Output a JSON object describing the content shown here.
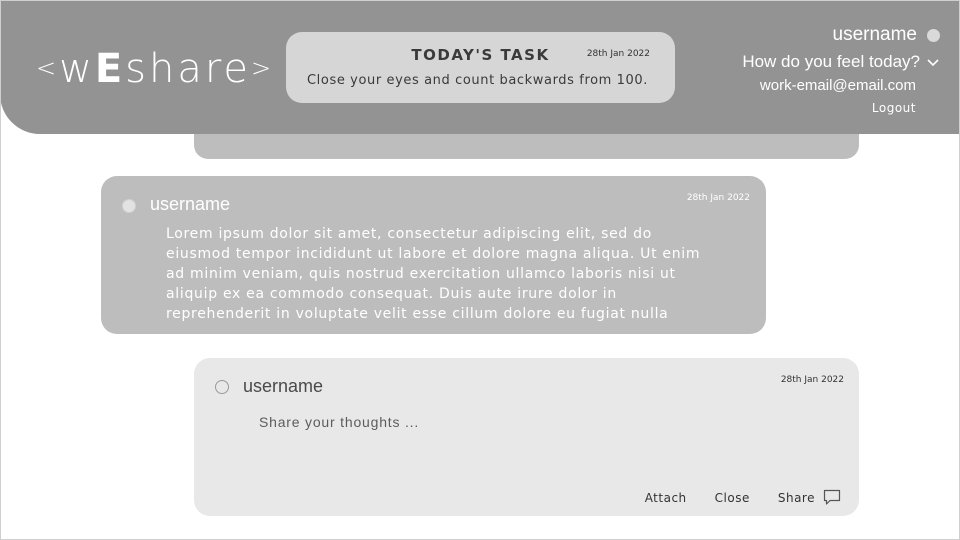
{
  "header": {
    "logo": {
      "open": "<",
      "pre": "w",
      "big": "E",
      "post": "share",
      "close": ">"
    },
    "task": {
      "title": "TODAY'S TASK",
      "date": "28th Jan 2022",
      "text": "Close your eyes and count backwards from 100."
    },
    "user": {
      "name": "username",
      "mood_prompt": "How do you feel today?",
      "email": "work-email@email.com",
      "logout_label": "Logout"
    }
  },
  "feed": {
    "post": {
      "username": "username",
      "date": "28th Jan 2022",
      "body": "Lorem ipsum dolor sit amet, consectetur adipiscing elit, sed do eiusmod tempor incididunt ut labore et dolore magna aliqua. Ut enim ad minim veniam, quis nostrud exercitation ullamco laboris nisi ut aliquip ex ea commodo consequat. Duis aute irure dolor in reprehenderit in voluptate velit esse cillum dolore eu fugiat nulla"
    },
    "compose": {
      "username": "username",
      "date": "28th Jan 2022",
      "placeholder": "Share your thoughts ...",
      "attach_label": "Attach",
      "close_label": "Close",
      "share_label": "Share"
    }
  },
  "colors": {
    "header_bg": "#939393",
    "post_bg": "#bdbdbd",
    "compose_bg": "#e8e8e8",
    "task_card_bg": "#d6d6d6"
  },
  "icons": {
    "avatar_dot": "user-status-dot",
    "mood_chevron": "chevron-down-icon",
    "share": "chat-bubble-icon"
  }
}
